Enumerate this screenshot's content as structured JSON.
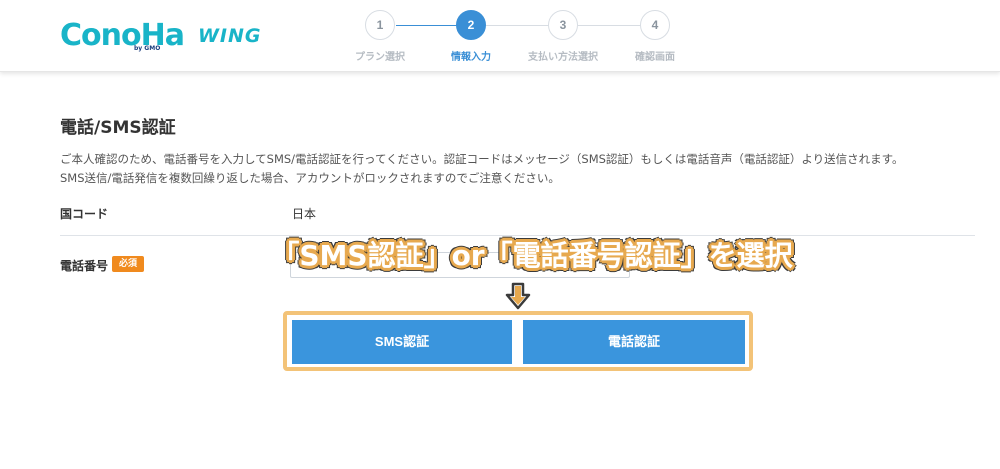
{
  "header": {
    "logo_main": "ConoHa",
    "logo_sub": "by GMO",
    "logo_wing": "WING",
    "steps": [
      {
        "number": "1",
        "label": "プラン選択",
        "active": false
      },
      {
        "number": "2",
        "label": "情報入力",
        "active": true
      },
      {
        "number": "3",
        "label": "支払い方法選択",
        "active": false
      },
      {
        "number": "4",
        "label": "確認画面",
        "active": false
      }
    ]
  },
  "main": {
    "title": "電話/SMS認証",
    "description_line1": "ご本人確認のため、電話番号を入力してSMS/電話認証を行ってください。認証コードはメッセージ（SMS認証）もしくは電話音声（電話認証）より送信されます。",
    "description_line2": "SMS送信/電話発信を複数回繰り返した場合、アカウントがロックされますのでご注意ください。",
    "country_label": "国コード",
    "country_value": "日本",
    "phone_label": "電話番号",
    "required_badge": "必須",
    "phone_value": ""
  },
  "annotation": {
    "text": "「SMS認証」or「電話番号認証」を選択",
    "arrow_icon": "arrow-down-icon"
  },
  "buttons": {
    "sms_label": "SMS認証",
    "tel_label": "電話認証"
  },
  "colors": {
    "brand": "#19b4c8",
    "accent": "#3a8fd6",
    "button": "#3a95dd",
    "required": "#f08a1e",
    "highlight": "#f3c378"
  }
}
